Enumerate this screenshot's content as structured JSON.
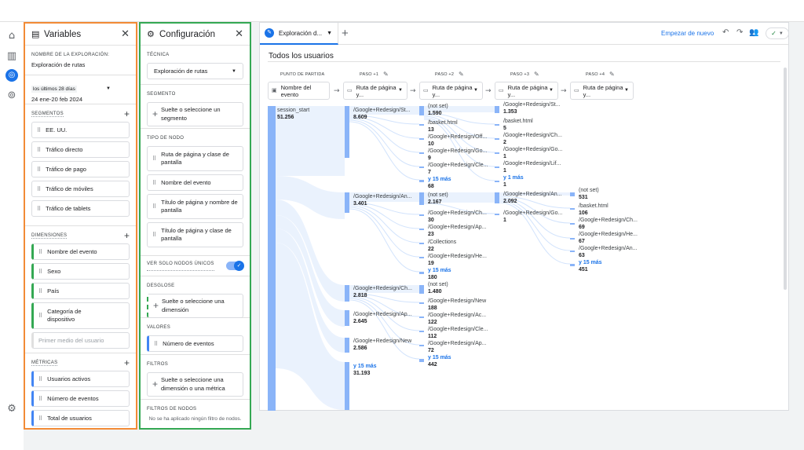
{
  "variables": {
    "title": "Variables",
    "name_label": "NOMBRE DE LA EXPLORACIÓN:",
    "name_value": "Exploración de rutas",
    "date_top": "los últimos 28 días",
    "date_range": "24 ene-20 feb 2024",
    "segments_label": "SEGMENTOS",
    "segments": [
      "EE. UU.",
      "Tráfico directo",
      "Tráfico de pago",
      "Tráfico de móviles",
      "Tráfico de tablets"
    ],
    "dimensions_label": "DIMENSIONES",
    "dimensions": [
      "Nombre del evento",
      "Sexo",
      "País",
      "Categoría de dispositivo"
    ],
    "dimension_placeholder": "Primer medio del usuario",
    "metrics_label": "MÉTRICAS",
    "metrics": [
      "Usuarios activos",
      "Número de eventos",
      "Total de usuarios"
    ]
  },
  "config": {
    "title": "Configuración",
    "technique_label": "TÉCNICA",
    "technique_value": "Exploración de rutas",
    "segment_label": "SEGMENTO",
    "segment_drop": "Suelte o seleccione un segmento",
    "nodetype_label": "TIPO DE NODO",
    "node_types": [
      "Ruta de página y clase de pantalla",
      "Nombre del evento",
      "Título de página y nombre de pantalla",
      "Título de página y clase de pantalla"
    ],
    "unique_label": "VER SOLO NODOS ÚNICOS",
    "breakdown_label": "DESGLOSE",
    "breakdown_drop": "Suelte o seleccione una dimensión",
    "values_label": "VALORES",
    "values_value": "Número de eventos",
    "filters_label": "FILTROS",
    "filters_drop": "Suelte o seleccione una dimensión o una métrica",
    "nodefilters_label": "FILTROS DE NODOS",
    "nodefilters_text": "No se ha aplicado ningún filtro de nodos."
  },
  "main": {
    "tab_label": "Exploración d...",
    "restart": "Empezar de nuevo",
    "chart_title": "Todos los usuarios",
    "steps": [
      {
        "label": "PUNTO DE PARTIDA",
        "dd": "Nombre del evento"
      },
      {
        "label": "PASO +1",
        "dd": "Ruta de página y..."
      },
      {
        "label": "PASO +2",
        "dd": "Ruta de página y..."
      },
      {
        "label": "PASO +3",
        "dd": "Ruta de página y..."
      },
      {
        "label": "PASO +4",
        "dd": "Ruta de página y..."
      }
    ],
    "start": {
      "label": "session_start",
      "value": "51.256"
    },
    "step1": [
      {
        "label": "/Google+Redesign/St...",
        "value": "8.609"
      },
      {
        "label": "/Google+Redesign/An...",
        "value": "3.401"
      },
      {
        "label": "/Google+Redesign/Ch...",
        "value": "2.818"
      },
      {
        "label": "/Google+Redesign/Ap...",
        "value": "2.645"
      },
      {
        "label": "/Google+Redesign/New",
        "value": "2.586"
      },
      {
        "label": "y 15 más",
        "value": "31.193"
      }
    ],
    "step2": [
      {
        "label": "(not set)",
        "value": "1.590"
      },
      {
        "label": "/basket.html",
        "value": "13"
      },
      {
        "label": "/Google+Redesign/Off...",
        "value": "10"
      },
      {
        "label": "/Google+Redesign/Go...",
        "value": "9"
      },
      {
        "label": "/Google+Redesign/Cle...",
        "value": "7"
      },
      {
        "label": "y 15 más",
        "value": "68"
      },
      {
        "label": "(not set)",
        "value": "2.167"
      },
      {
        "label": "/Google+Redesign/Ch...",
        "value": "30"
      },
      {
        "label": "/Google+Redesign/Ap...",
        "value": "23"
      },
      {
        "label": "/Collections",
        "value": "22"
      },
      {
        "label": "/Google+Redesign/He...",
        "value": "19"
      },
      {
        "label": "y 15 más",
        "value": "180"
      },
      {
        "label": "(not set)",
        "value": "1.480"
      },
      {
        "label": "/Google+Redesign/New",
        "value": "188"
      },
      {
        "label": "/Google+Redesign/Ac...",
        "value": "122"
      },
      {
        "label": "/Google+Redesign/Cle...",
        "value": "112"
      },
      {
        "label": "/Google+Redesign/Ap...",
        "value": "72"
      },
      {
        "label": "y 15 más",
        "value": "442"
      }
    ],
    "step3": [
      {
        "label": "/Google+Redesign/St...",
        "value": "1.353"
      },
      {
        "label": "/basket.html",
        "value": "5"
      },
      {
        "label": "/Google+Redesign/Ch...",
        "value": "2"
      },
      {
        "label": "/Google+Redesign/Go...",
        "value": "1"
      },
      {
        "label": "/Google+Redesign/Lif...",
        "value": "1"
      },
      {
        "label": "y 1 más",
        "value": "1"
      },
      {
        "label": "/Google+Redesign/An...",
        "value": "2.092"
      },
      {
        "label": "/Google+Redesign/Go...",
        "value": "1"
      }
    ],
    "step4": [
      {
        "label": "(not set)",
        "value": "531"
      },
      {
        "label": "/basket.html",
        "value": "106"
      },
      {
        "label": "/Google+Redesign/Ch...",
        "value": "69"
      },
      {
        "label": "/Google+Redesign/He...",
        "value": "67"
      },
      {
        "label": "/Google+Redesign/An...",
        "value": "63"
      },
      {
        "label": "y 15 más",
        "value": "451"
      }
    ]
  }
}
